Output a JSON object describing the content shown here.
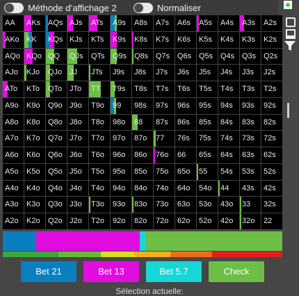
{
  "header": {
    "toggle1_label": "Méthode d’affichage 2",
    "toggle2_label": "Normaliser"
  },
  "colors": {
    "bet21": "#0a7fbf",
    "bet13": "#e10ddf",
    "bet57": "#18d6d6",
    "check": "#6dbe45",
    "cell_bg": "#000000"
  },
  "grid": [
    [
      "AA",
      "AKs",
      "AQs",
      "AJs",
      "ATs",
      "A9s",
      "A8s",
      "A7s",
      "A6s",
      "A5s",
      "A4s",
      "A3s",
      "A2s"
    ],
    [
      "AKo",
      "KK",
      "KQs",
      "KJs",
      "KTs",
      "K9s",
      "K8s",
      "K7s",
      "K6s",
      "K5s",
      "K4s",
      "K3s",
      "K2s"
    ],
    [
      "AQo",
      "KQo",
      "QQ",
      "QJs",
      "QTs",
      "Q9s",
      "Q8s",
      "Q7s",
      "Q6s",
      "Q5s",
      "Q4s",
      "Q3s",
      "Q2s"
    ],
    [
      "AJo",
      "KJo",
      "QJo",
      "JJ",
      "JTs",
      "J9s",
      "J8s",
      "J7s",
      "J6s",
      "J5s",
      "J4s",
      "J3s",
      "J2s"
    ],
    [
      "ATo",
      "KTo",
      "QTo",
      "JTo",
      "TT",
      "T9s",
      "T8s",
      "T7s",
      "T6s",
      "T5s",
      "T4s",
      "T3s",
      "T2s"
    ],
    [
      "A9o",
      "K9o",
      "Q9o",
      "J9o",
      "T9o",
      "99",
      "98s",
      "97s",
      "96s",
      "95s",
      "94s",
      "93s",
      "92s"
    ],
    [
      "A8o",
      "K8o",
      "Q8o",
      "J8o",
      "T8o",
      "98o",
      "88",
      "87s",
      "86s",
      "85s",
      "84s",
      "83s",
      "82s"
    ],
    [
      "A7o",
      "K7o",
      "Q7o",
      "J7o",
      "T7o",
      "97o",
      "87o",
      "77",
      "76s",
      "75s",
      "74s",
      "73s",
      "72s"
    ],
    [
      "A6o",
      "K6o",
      "Q6o",
      "J6o",
      "T6o",
      "96o",
      "86o",
      "76o",
      "66",
      "65s",
      "64s",
      "63s",
      "62s"
    ],
    [
      "A5o",
      "K5o",
      "Q5o",
      "J5o",
      "T5o",
      "95o",
      "85o",
      "75o",
      "65o",
      "55",
      "54s",
      "53s",
      "52s"
    ],
    [
      "A4o",
      "K4o",
      "Q4o",
      "J4o",
      "T4o",
      "94o",
      "84o",
      "74o",
      "64o",
      "54o",
      "44",
      "43s",
      "42s"
    ],
    [
      "A3o",
      "K3o",
      "Q3o",
      "J3o",
      "T3o",
      "93o",
      "83o",
      "73o",
      "63o",
      "53o",
      "43o",
      "33",
      "32s"
    ],
    [
      "A2o",
      "K2o",
      "Q2o",
      "J2o",
      "T2o",
      "92o",
      "82o",
      "72o",
      "62o",
      "52o",
      "42o",
      "32o",
      "22"
    ]
  ],
  "cell_mix": {
    "0,1": [
      [
        "#e10ddf",
        0.32
      ]
    ],
    "0,2": [
      [
        "#0a7fbf",
        0.05
      ],
      [
        "#e10ddf",
        0.05
      ]
    ],
    "0,3": [
      [
        "#e10ddf",
        0.25
      ]
    ],
    "0,4": [
      [
        "#e10ddf",
        0.4
      ]
    ],
    "0,5": [
      [
        "#0a7fbf",
        0.2
      ],
      [
        "#6dbe45",
        0.1
      ]
    ],
    "0,9": [
      [
        "#e10ddf",
        0.1
      ]
    ],
    "0,11": [
      [
        "#e10ddf",
        0.2
      ]
    ],
    "1,0": [
      [
        "#e10ddf",
        0.12
      ]
    ],
    "1,1": [
      [
        "#6dbe45",
        0.2
      ],
      [
        "#0a7fbf",
        0.15
      ]
    ],
    "1,2": [
      [
        "#0a7fbf",
        0.15
      ],
      [
        "#e10ddf",
        0.25
      ]
    ],
    "1,5": [
      [
        "#e10ddf",
        0.3
      ]
    ],
    "1,6": [
      [
        "#e10ddf",
        0.05
      ]
    ],
    "2,1": [
      [
        "#e10ddf",
        0.4
      ]
    ],
    "2,2": [
      [
        "#6dbe45",
        0.4
      ]
    ],
    "2,3": [
      [
        "#6dbe45",
        0.45
      ]
    ],
    "2,5": [
      [
        "#6dbe45",
        0.3
      ]
    ],
    "2,6": [
      [
        "#6dbe45",
        0.05
      ]
    ],
    "3,1": [
      [
        "#6dbe45",
        0.1
      ]
    ],
    "3,2": [
      [
        "#6dbe45",
        0.2
      ]
    ],
    "3,3": [
      [
        "#6dbe45",
        0.3
      ]
    ],
    "3,4": [
      [
        "#6dbe45",
        0.08
      ]
    ],
    "4,0": [
      [
        "#e10ddf",
        0.22
      ]
    ],
    "4,2": [
      [
        "#6dbe45",
        0.2
      ]
    ],
    "4,4": [
      [
        "#6dbe45",
        0.55
      ]
    ],
    "4,5": [
      [
        "#6dbe45",
        0.2
      ]
    ],
    "5,5": [
      [
        "#0a7fbf",
        0.15
      ],
      [
        "#6dbe45",
        0.1
      ]
    ],
    "6,6": [
      [
        "#6dbe45",
        0.25
      ]
    ],
    "7,7": [
      [
        "#6dbe45",
        0.1
      ]
    ],
    "8,7": [
      [
        "#e10ddf",
        0.06
      ]
    ],
    "9,9": [
      [
        "#6dbe45",
        0.05
      ]
    ],
    "10,10": [
      [
        "#6dbe45",
        0.05
      ]
    ],
    "11,4": [
      [
        "#6dbe45",
        0.08
      ]
    ],
    "11,6": [
      [
        "#6dbe45",
        0.05
      ]
    ],
    "11,11": [
      [
        "#6dbe45",
        0.06
      ]
    ],
    "12,11": [
      [
        "#6dbe45",
        0.05
      ]
    ]
  },
  "distribution_bar": [
    [
      "#0a7fbf",
      0.12
    ],
    [
      "#e10ddf",
      0.37
    ],
    [
      "#18d6d6",
      0.02
    ],
    [
      "#6dbe45",
      0.49
    ]
  ],
  "color_stripe": [
    [
      "#3aa83a",
      0.2
    ],
    [
      "#66bb33",
      0.15
    ],
    [
      "#d8e018",
      0.12
    ],
    [
      "#f2b01a",
      0.13
    ],
    [
      "#f06a1a",
      0.15
    ],
    [
      "#e81c1c",
      0.25
    ]
  ],
  "buttons": {
    "bet21": "Bet 21",
    "bet13": "Bet 13",
    "bet57": "Bet 5.7",
    "check": "Check"
  },
  "footer_text": "Sélection actuelle:"
}
